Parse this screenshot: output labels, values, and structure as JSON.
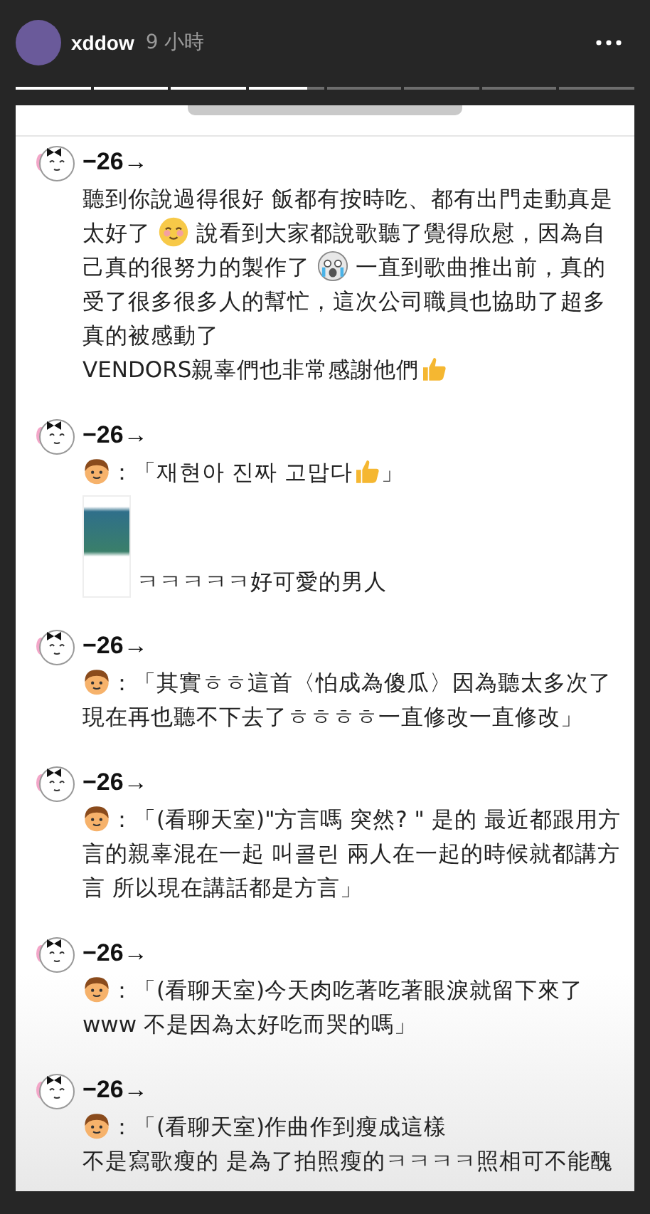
{
  "story": {
    "username": "xddow",
    "time": "9 小時",
    "segments": [
      {
        "level": 1
      },
      {
        "level": 1
      },
      {
        "level": 1
      },
      {
        "level": 0.78
      },
      {
        "level": 0
      },
      {
        "level": 0
      },
      {
        "level": 0
      },
      {
        "level": 0
      }
    ]
  },
  "posts": [
    {
      "author": "−26→",
      "paragraphs": [
        [
          {
            "kind": "text",
            "text": "聽到你說過得很好 飯都有按時吃、都有出門走動真是太好了 "
          },
          {
            "kind": "smile"
          },
          {
            "kind": "text",
            "text": " 說看到大家都說歌聽了覺得欣慰，因為自己真的很努力的製作了 "
          },
          {
            "kind": "scream"
          },
          {
            "kind": "text",
            "text": " 一直到歌曲推出前，真的受了很多很多人的幫忙，這次公司職員也協助了超多真的被感動了"
          }
        ],
        [
          {
            "kind": "text",
            "text": "VENDORS親辜們也非常感謝他們"
          },
          {
            "kind": "thumb"
          }
        ]
      ]
    },
    {
      "author": "−26→",
      "paragraphs": [
        [
          {
            "kind": "boy"
          },
          {
            "kind": "text",
            "text": "：「재현아 진짜 고맙다"
          },
          {
            "kind": "thumb"
          },
          {
            "kind": "text",
            "text": "」"
          }
        ],
        [
          {
            "kind": "photo"
          },
          {
            "kind": "text",
            "text": "ㅋㅋㅋㅋㅋ好可愛的男人"
          }
        ]
      ]
    },
    {
      "author": "−26→",
      "paragraphs": [
        [
          {
            "kind": "boy"
          },
          {
            "kind": "text",
            "text": "：「其實ㅎㅎ這首〈怕成為傻瓜〉因為聽太多次了現在再也聽不下去了ㅎㅎㅎㅎ一直修改一直修改」"
          }
        ]
      ]
    },
    {
      "author": "−26→",
      "paragraphs": [
        [
          {
            "kind": "boy"
          },
          {
            "kind": "text",
            "text": "：「(看聊天室)\"方言嗎 突然? \" 是的 最近都跟用方言的親辜混在一起 叫콜린 兩人在一起的時候就都講方言 所以現在講話都是方言」"
          }
        ]
      ]
    },
    {
      "author": "−26→",
      "paragraphs": [
        [
          {
            "kind": "boy"
          },
          {
            "kind": "text",
            "text": "：「(看聊天室)今天肉吃著吃著眼淚就留下來了www 不是因為太好吃而哭的嗎」"
          }
        ]
      ]
    },
    {
      "author": "−26→",
      "paragraphs": [
        [
          {
            "kind": "boy"
          },
          {
            "kind": "text",
            "text": "：「(看聊天室)作曲作到瘦成這樣"
          }
        ],
        [
          {
            "kind": "text",
            "text": "不是寫歌瘦的 是為了拍照瘦的ㅋㅋㅋㅋ照相可不能醜"
          }
        ]
      ]
    }
  ]
}
